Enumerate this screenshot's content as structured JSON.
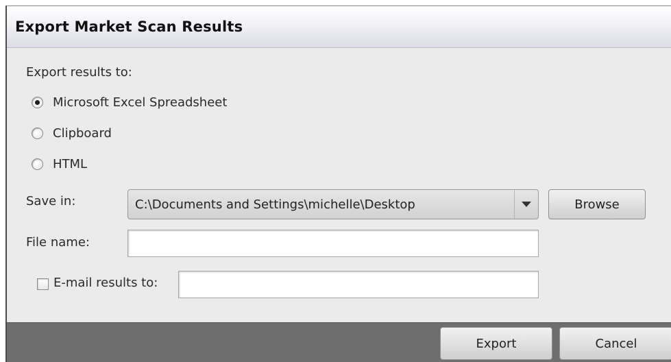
{
  "dialog": {
    "title": "Export Market Scan Results"
  },
  "export": {
    "heading": "Export results to:",
    "options": [
      {
        "label": "Microsoft Excel Spreadsheet",
        "selected": true
      },
      {
        "label": "Clipboard",
        "selected": false
      },
      {
        "label": "HTML",
        "selected": false
      }
    ]
  },
  "save_in": {
    "label": "Save in:",
    "value": "C:\\Documents and Settings\\michelle\\Desktop",
    "browse_label": "Browse"
  },
  "file_name": {
    "label": "File name:",
    "value": ""
  },
  "email": {
    "label": "E-mail results to:",
    "checked": false,
    "value": ""
  },
  "footer": {
    "export_label": "Export",
    "cancel_label": "Cancel"
  },
  "icons": {
    "dropdown": "chevron-down-icon"
  }
}
